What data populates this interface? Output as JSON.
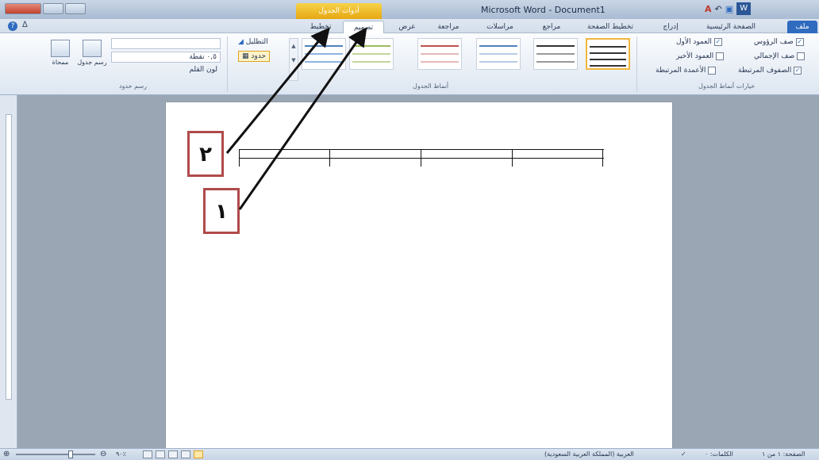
{
  "titlebar": {
    "contextual_label": "أدوات الجدول",
    "app_title": "Microsoft Word - Document1",
    "font_color_glyph": "A",
    "undo_glyph": "↶",
    "save_glyph": "▣",
    "word_glyph": "W"
  },
  "tabs": {
    "file": "ملف",
    "home": "الصفحة الرئيسية",
    "insert": "إدراج",
    "page_layout": "تخطيط الصفحة",
    "references": "مراجع",
    "mailings": "مراسلات",
    "review": "مراجعة",
    "view": "عرض",
    "design": "تصميم",
    "layout": "تخطيط",
    "help_glyph": "?",
    "minimize_glyph": "ᐃ"
  },
  "ribbon": {
    "style_options": {
      "header_row": "صف الرؤوس",
      "first_column": "العمود الأول",
      "total_row": "صف الإجمالي",
      "last_column": "العمود الأخير",
      "banded_rows": "الصفوف المرتبطة",
      "banded_columns": "الأعمدة المرتبطة",
      "caption": "خيارات أنماط الجدول",
      "checked_glyph": "✓"
    },
    "table_styles": {
      "caption": "أنماط الجدول",
      "scroll_up": "▲",
      "scroll_down": "▼"
    },
    "shading_label": "التظليل",
    "borders_label": "حدود",
    "draw_borders": {
      "pen_weight": "٠,٥ نقطة",
      "pen_color": "لون القلم",
      "draw_table": "رسم جدول",
      "eraser": "ممحاة",
      "caption": "رسم حدود"
    }
  },
  "callouts": {
    "one": "١",
    "two": "٢"
  },
  "statusbar": {
    "page": "الصفحة: ١ من ١",
    "words": "الكلمات: ٠",
    "language": "العربية (المملكة العربية السعودية)",
    "zoom": "٩٠٪"
  },
  "colors": {
    "callout_border": "#b04a4a",
    "file_tab": "#2f6bbf",
    "contextual_tab": "#f0b63f"
  }
}
